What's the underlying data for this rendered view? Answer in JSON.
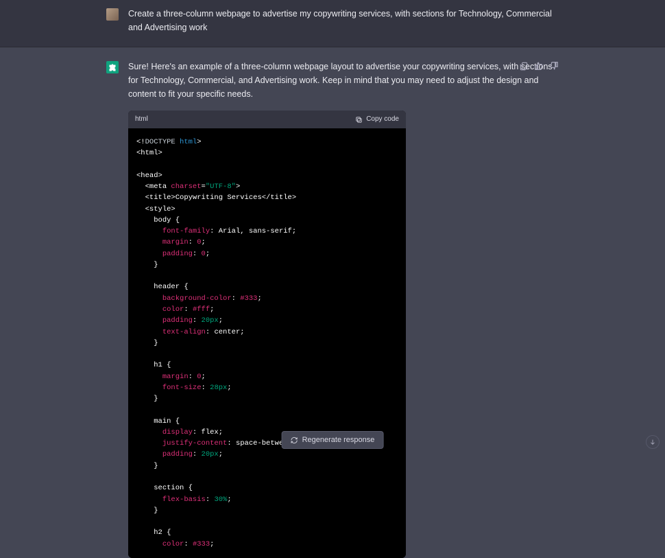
{
  "user": {
    "prompt": "Create a three-column webpage to advertise my copywriting services, with sections for Technology, Commercial and Advertising work"
  },
  "assistant": {
    "intro": "Sure! Here's an example of a three-column webpage layout to advertise your copywriting services, with sections for Technology, Commercial, and Advertising work. Keep in mind that you may need to adjust the design and content to fit your specific needs."
  },
  "code": {
    "lang": "html",
    "copy_label": "Copy code",
    "title_text": "Copywriting Services",
    "charset_attr": "charset",
    "charset_val": "\"UTF-8\"",
    "css": {
      "body_font_prop": "font-family",
      "body_font_val": "Arial, sans-serif",
      "body_margin_prop": "margin",
      "body_margin_val": "0",
      "body_padding_prop": "padding",
      "body_padding_val": "0",
      "header_bg_prop": "background-color",
      "header_bg_val": "#333",
      "header_color_prop": "color",
      "header_color_val": "#fff",
      "header_padding_prop": "padding",
      "header_padding_val": "20px",
      "header_align_prop": "text-align",
      "header_align_val": "center",
      "h1_margin_prop": "margin",
      "h1_margin_val": "0",
      "h1_fs_prop": "font-size",
      "h1_fs_val": "28px",
      "main_display_prop": "display",
      "main_display_val": "flex",
      "main_jc_prop": "justify-content",
      "main_jc_val": "space-between",
      "main_padding_prop": "padding",
      "main_padding_val": "20px",
      "section_fb_prop": "flex-basis",
      "section_fb_val": "30%",
      "h2_color_prop": "color",
      "h2_color_val": "#333"
    }
  },
  "actions": {
    "regenerate": "Regenerate response"
  }
}
